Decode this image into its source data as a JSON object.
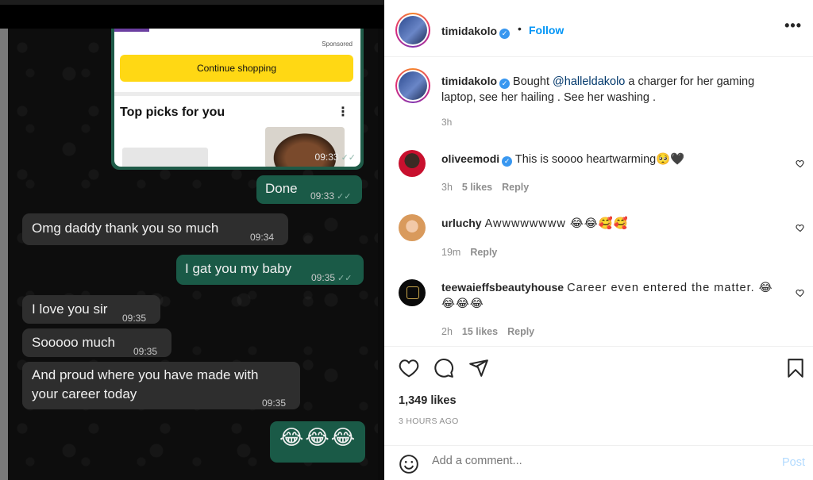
{
  "media": {
    "amazon": {
      "sponsored": "Sponsored",
      "continue_label": "Continue shopping",
      "top_picks": "Top picks for you",
      "time": "09:33"
    },
    "messages": [
      {
        "text": "Done",
        "time": "09:33",
        "direction": "out"
      },
      {
        "text": "Omg daddy thank you so much",
        "time": "09:34",
        "direction": "in"
      },
      {
        "text": "I gat you my baby",
        "time": "09:35",
        "direction": "out"
      },
      {
        "text": "I love you sir",
        "time": "09:35",
        "direction": "in"
      },
      {
        "text": "Sooooo much",
        "time": "09:35",
        "direction": "in"
      },
      {
        "text": "And proud where you have made with your career today",
        "time": "09:35",
        "direction": "in"
      },
      {
        "text": "😂😂😂",
        "time": "",
        "direction": "out"
      }
    ]
  },
  "post": {
    "author": "timidakolo",
    "separator": "•",
    "follow_label": "Follow",
    "caption": {
      "before": "Bought",
      "mention": "@halleldakolo",
      "after": "a charger for her gaming laptop, see her hailing . See her washing .",
      "time": "3h"
    },
    "likes": "1,349 likes",
    "posted": "3 HOURS AGO"
  },
  "comments": [
    {
      "user": "oliveemodi",
      "text": "This is soooo heartwarming🥺🖤",
      "time": "3h",
      "likes": "5 likes",
      "reply": "Reply"
    },
    {
      "user": "urluchy",
      "text": "Awwwwwwww 😂😂🥰🥰",
      "time": "19m",
      "reply": "Reply"
    },
    {
      "user": "teewaieffsbeautyhouse",
      "text": "Career even entered the matter. 😂😂😂😂",
      "time": "2h",
      "likes": "15 likes",
      "reply": "Reply"
    }
  ],
  "composer": {
    "placeholder": "Add a comment...",
    "post_label": "Post"
  },
  "colors": {
    "outgoing_bubble": "#1a5a47",
    "incoming_bubble": "#2e2e2e",
    "follow_blue": "#0095f6",
    "post_button_disabled": "#b3dbff"
  }
}
